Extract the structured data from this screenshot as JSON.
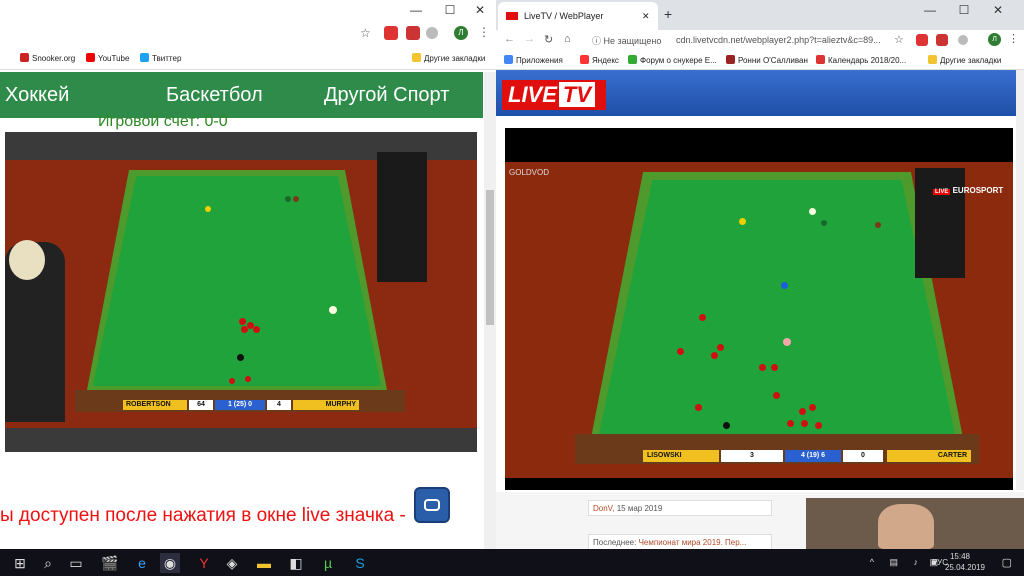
{
  "left": {
    "bookmarks": [
      "Snooker.org",
      "YouTube",
      "Твиттер"
    ],
    "nav": [
      "Хоккей",
      "Баскетбол",
      "Другой Спорт"
    ],
    "score": "Игровой счет: 0-0",
    "scoreboard": {
      "p1": "ROBERTSON",
      "s1": "64",
      "frames": "1 (25) 0",
      "s2": "4",
      "p2": "MURPHY"
    },
    "message": "ы доступен после нажатия в окне live значка -"
  },
  "right": {
    "tab_title": "LiveTV / WebPlayer",
    "insecure": "Не защищено",
    "url": "cdn.livetvcdn.net/webplayer2.php?t=alieztv&c=89...",
    "bookmarks": [
      "Приложения",
      "Яндекс",
      "Форум о снукере E...",
      "Ронни О'Салливан",
      "Календарь 2018/20...",
      "Другие закладки"
    ],
    "logo_live": "LIVE",
    "logo_tv": "TV",
    "channel": "EUROSPORT",
    "brand": "GOLDVOD",
    "scoreboard": {
      "p1": "LISOWSKI",
      "s1": "3",
      "frames": "4 (19) 6",
      "s2": "0",
      "p2": "CARTER"
    },
    "posts": [
      {
        "author": "DonV,",
        "date": "15 мар 2019"
      },
      {
        "label": "Последнее:",
        "title": "Чемпионат мира 2019. Пер..."
      }
    ]
  },
  "left_bm_other": "Другие закладки",
  "tray": {
    "lang": "РУС",
    "time": "15:48",
    "date": "25.04.2019"
  }
}
